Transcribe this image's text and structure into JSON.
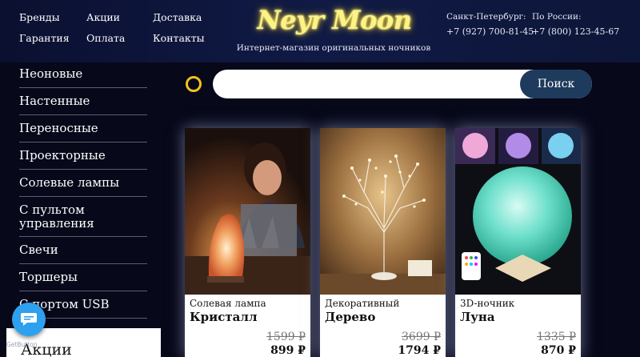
{
  "nav": {
    "items": [
      "Бренды",
      "Акции",
      "Доставка",
      "Гарантия",
      "Оплата",
      "Контакты"
    ]
  },
  "brand": {
    "logo": "Neyr Moon",
    "tagline": "Интернет-магазин оригинальных ночников"
  },
  "contacts": [
    {
      "city": "Санкт-Петербург:",
      "phone": "+7 (927) 700-81-45"
    },
    {
      "city": "По России:",
      "phone": "+7 (800) 123-45-67"
    }
  ],
  "sidebar": {
    "items": [
      "Неоновые",
      "Настенные",
      "Переносные",
      "Проекторные",
      "Солевые лампы",
      "С пультом управления",
      "Свечи",
      "Торшеры",
      "С портом USB"
    ],
    "promo": "Акции"
  },
  "search": {
    "placeholder": "",
    "button": "Поиск"
  },
  "products": [
    {
      "subtitle": "Солевая лампа",
      "name": "Кристалл",
      "old_price": "1599 ₽",
      "price": "899 ₽"
    },
    {
      "subtitle": "Декоративный",
      "name": "Дерево",
      "old_price": "3699 ₽",
      "price": "1794 ₽"
    },
    {
      "subtitle": "3D-ночник",
      "name": "Луна",
      "old_price": "1335 ₽",
      "price": "870 ₽"
    }
  ],
  "widget": {
    "label": "GetButton",
    "icon": "chat-icon"
  },
  "colors": {
    "accent": "#f2c21b",
    "search_button": "#1e3a5c",
    "logo": "#fbf38a"
  }
}
